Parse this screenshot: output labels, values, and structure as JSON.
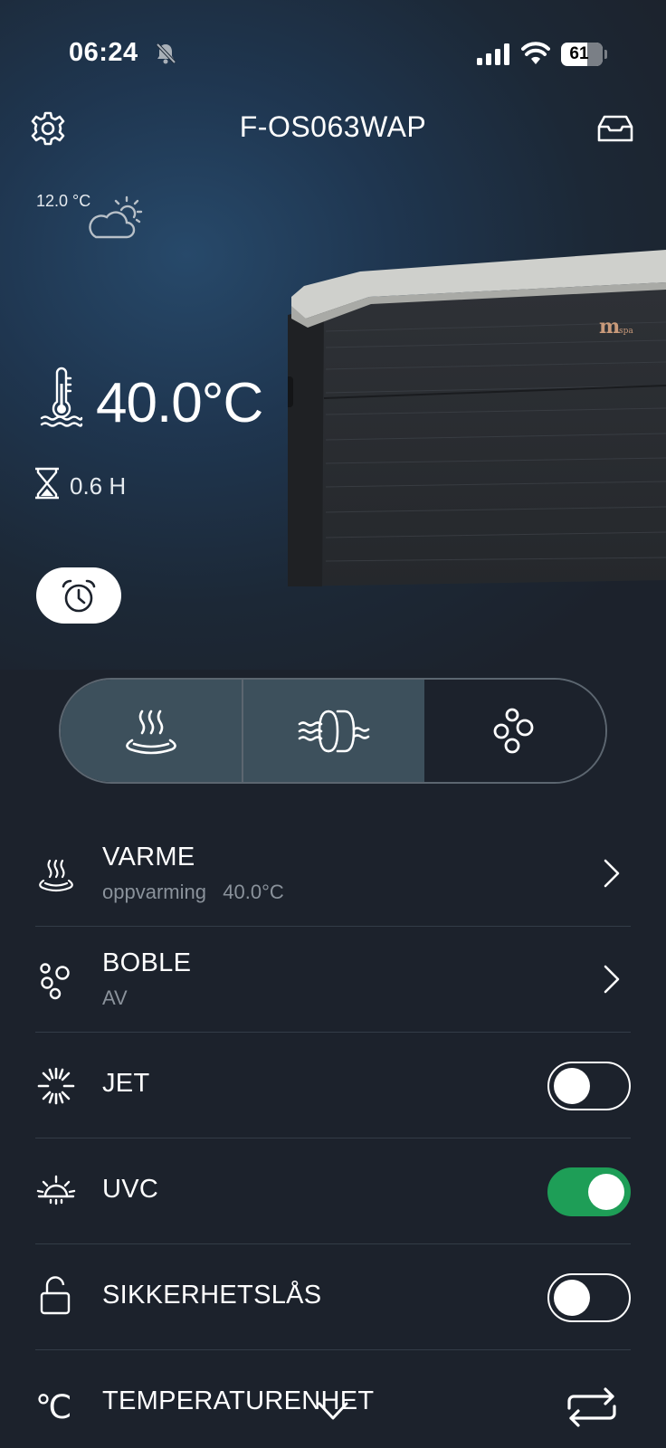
{
  "status_bar": {
    "time": "06:24",
    "battery": "61"
  },
  "header": {
    "title": "F-OS063WAP"
  },
  "weather": {
    "temp": "12.0 °C",
    "icon": "partly-cloudy-icon"
  },
  "spa": {
    "current_temp": "40.0°C",
    "time_remaining": "0.6 H",
    "brand": "mspa"
  },
  "modes": [
    {
      "name": "heat",
      "active": true
    },
    {
      "name": "filter",
      "active": true
    },
    {
      "name": "bubble",
      "active": false
    }
  ],
  "list": {
    "heat": {
      "label": "VARME",
      "status": "oppvarming",
      "value": "40.0°C"
    },
    "bubble": {
      "label": "BOBLE",
      "status": "AV"
    },
    "jet": {
      "label": "JET",
      "on": false
    },
    "uvc": {
      "label": "UVC",
      "on": true
    },
    "lock": {
      "label": "SIKKERHETSLÅS",
      "on": false
    },
    "unit": {
      "label": "TEMPERATURENHET",
      "symbol": "℃"
    }
  },
  "colors": {
    "background": "#1c222c",
    "toggle_on": "#1e9e57",
    "active_mode": "#3d505c"
  }
}
